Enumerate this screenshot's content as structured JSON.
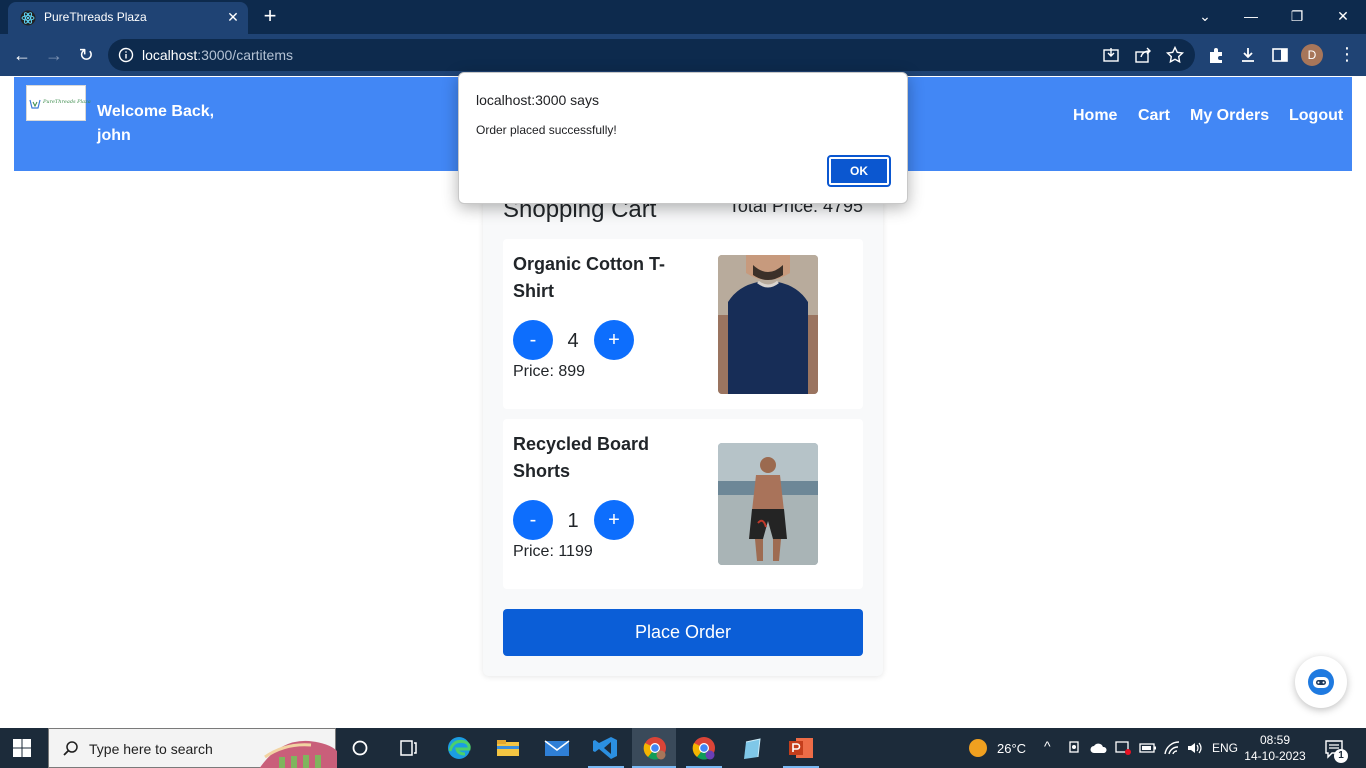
{
  "browser": {
    "tab_title": "PureThreads Plaza",
    "url_host": "localhost",
    "url_path": ":3000/cartitems",
    "profile_initial": "D"
  },
  "site": {
    "logo_text": "PureThreads Plaza",
    "welcome": "Welcome Back, john",
    "nav": [
      "Home",
      "Cart",
      "My Orders",
      "Logout"
    ]
  },
  "cart": {
    "title": "Shopping Cart",
    "total_label": "Total Price: 4795",
    "items": [
      {
        "name": "Organic Cotton T-Shirt",
        "minus": "-",
        "qty": "4",
        "plus": "+",
        "price": "Price: 899"
      },
      {
        "name": "Recycled Board Shorts",
        "minus": "-",
        "qty": "1",
        "plus": "+",
        "price": "Price: 1199"
      }
    ],
    "place_order": "Place Order"
  },
  "dialog": {
    "title": "localhost:3000 says",
    "message": "Order placed successfully!",
    "ok": "OK"
  },
  "taskbar": {
    "search_placeholder": "Type here to search",
    "weather": "26°C",
    "lang": "ENG",
    "time": "08:59",
    "date": "14-10-2023",
    "notifications": "1"
  },
  "colors": {
    "header": "#4287f5",
    "primary": "#0d6efd",
    "place_order": "#0b5ed7",
    "chrome": "#1f4374"
  }
}
